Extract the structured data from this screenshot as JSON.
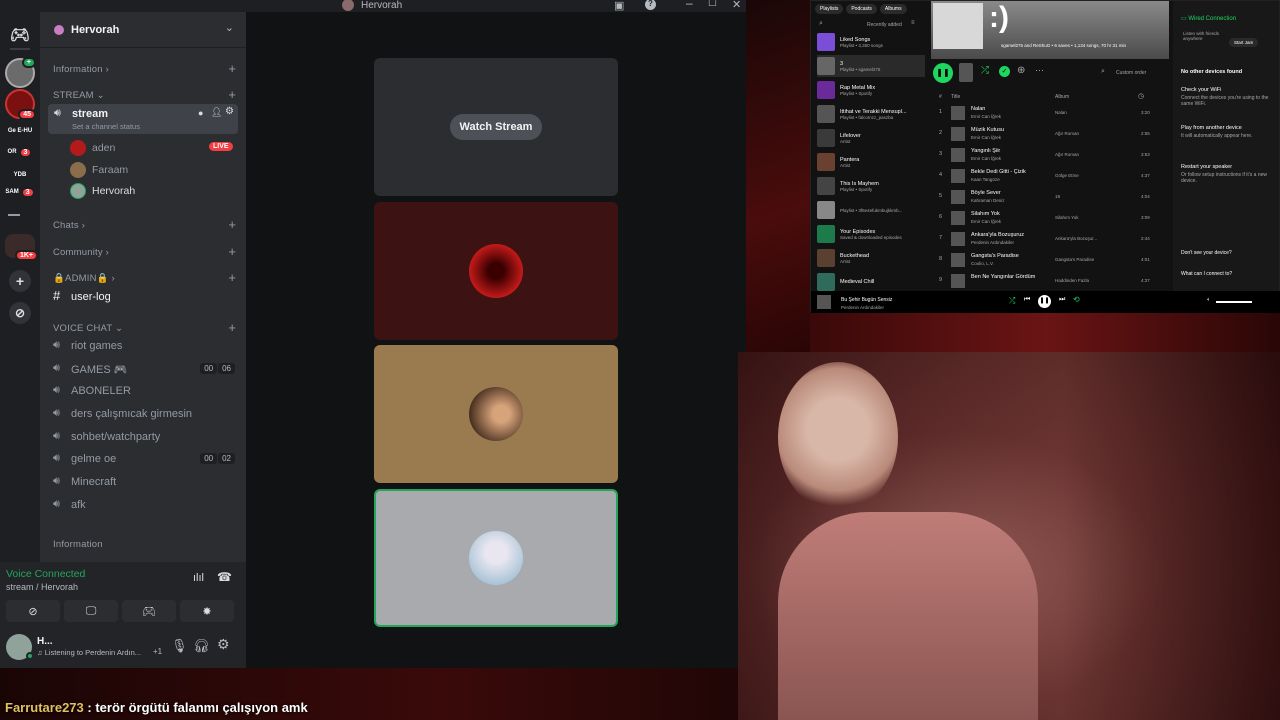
{
  "discord": {
    "window_title": "Hervorah",
    "server_name": "Hervorah",
    "servers": [
      {
        "label": "",
        "badge": ""
      },
      {
        "label": "",
        "badge": "45"
      },
      {
        "label": "Ge E-HU",
        "badge": ""
      },
      {
        "label": "OR",
        "badge": "3"
      },
      {
        "label": "YDB",
        "badge": ""
      },
      {
        "label": "SAM",
        "badge": "3"
      },
      {
        "label": "",
        "badge": "1K+"
      }
    ],
    "sections": {
      "information": "Information",
      "stream": "STREAM",
      "chats": "Chats",
      "community": "Community",
      "admin": "🔒ADMIN🔒",
      "voice_chat": "VOICE CHAT",
      "information2": "Information"
    },
    "stream_channel": {
      "name": "stream",
      "status": "Set a channel status"
    },
    "members": [
      {
        "name": "aden",
        "live": "LIVE"
      },
      {
        "name": "Faraam",
        "live": ""
      },
      {
        "name": "Hervorah",
        "live": ""
      }
    ],
    "text_channel": "user-log",
    "voice_channels": [
      {
        "name": "riot games",
        "c1": "",
        "c2": ""
      },
      {
        "name": "GAMES 🎮",
        "c1": "00",
        "c2": "06"
      },
      {
        "name": "ABONELER",
        "c1": "",
        "c2": ""
      },
      {
        "name": "ders çalışmıcak girmesin",
        "c1": "",
        "c2": ""
      },
      {
        "name": "sohbet/watchparty",
        "c1": "",
        "c2": ""
      },
      {
        "name": "gelme oe",
        "c1": "00",
        "c2": "02"
      },
      {
        "name": "Minecraft",
        "c1": "",
        "c2": ""
      },
      {
        "name": "afk",
        "c1": "",
        "c2": ""
      }
    ],
    "voice_connected": {
      "title": "Voice Connected",
      "sub": "stream / Hervorah"
    },
    "user": {
      "name": "H...",
      "activity": "Listening to Perdenin Ardın...",
      "extra": "+1"
    },
    "watch_stream": "Watch Stream",
    "colors": {
      "accent": "#23a55a",
      "live": "#f23f43"
    }
  },
  "spotify": {
    "tabs": [
      "Playlists",
      "Podcasts",
      "Albums"
    ],
    "sort": "Recently added",
    "library": [
      {
        "t": "Liked Songs",
        "s": "Playlist • 3,350 songs"
      },
      {
        "t": "3",
        "s": "Playlist • sgamel275"
      },
      {
        "t": "Rap Metal Mix",
        "s": "Playlist • Spotify"
      },
      {
        "t": "İttihat ve Terakki Mensupl...",
        "s": "Playlist • falcomzz_paszba"
      },
      {
        "t": "Lifelover",
        "s": "Artist"
      },
      {
        "t": "Pantera",
        "s": "Artist"
      },
      {
        "t": "This Is Mayhem",
        "s": "Playlist • Spotify"
      },
      {
        "t": "",
        "s": "Playlist • 3f6e4efukmbujkkmb..."
      },
      {
        "t": "Your Episodes",
        "s": "Saved & downloaded episodes"
      },
      {
        "t": "Buckethead",
        "s": "Artist"
      },
      {
        "t": "Medieval Chill",
        "s": ""
      }
    ],
    "playlist_title": ":)",
    "playlist_meta": "sgamel275 and ReShuG • 6 saves • 1,134 songs, 70 hr 31 min",
    "custom_order": "Custom order",
    "col_title": "Title",
    "col_album": "Album",
    "tracks": [
      {
        "n": "1",
        "t": "Nalan",
        "a": "Emir Can İğrek",
        "al": "Nalan",
        "d": "3:20"
      },
      {
        "n": "2",
        "t": "Müzik Kutusu",
        "a": "Emir Can İğrek",
        "al": "Ağır Roman",
        "d": "2:55"
      },
      {
        "n": "3",
        "t": "Yangınlı Şiir",
        "a": "Emir Can İğrek",
        "al": "Ağır Roman",
        "d": "3:53"
      },
      {
        "n": "4",
        "t": "Bekle Dedi Gitti - Çizik",
        "a": "Kaan Tangöze",
        "al": "Gölge Etme",
        "d": "4:37"
      },
      {
        "n": "5",
        "t": "Böyle Sever",
        "a": "Kahraman Deniz",
        "al": "19",
        "d": "4:04"
      },
      {
        "n": "6",
        "t": "Silahım Yok",
        "a": "Emir Can İğrek",
        "al": "Silahım Yok",
        "d": "3:09"
      },
      {
        "n": "7",
        "t": "Ankara'yla Bozuşuruz",
        "a": "Perdenin Ardındakiler",
        "al": "Ankara'yla Bozuşur...",
        "d": "2:44"
      },
      {
        "n": "8",
        "t": "Gangsta's Paradise",
        "a": "Coolio, L.V.",
        "al": "Gangsta's Paradise",
        "d": "4:01"
      },
      {
        "n": "9",
        "t": "Ben Ne Yangınlar Gördüm",
        "a": "",
        "al": "Haddinden Fazla",
        "d": "4:37"
      }
    ],
    "now_playing": {
      "t": "Bu Şehir Bugün Sensiz",
      "a": "Perdenin Ardındakiler"
    },
    "devices": {
      "current": "Wired Connection",
      "listen": "Listen with friends anywhere",
      "start_jam": "Start Jam",
      "no_other": "No other devices found",
      "wifi_t": "Check your WiFi",
      "wifi_s": "Connect the devices you're using to the same WiFi.",
      "play_t": "Play from another device",
      "play_s": "It will automatically appear here.",
      "restart_t": "Restart your speaker",
      "restart_s": "Or follow setup instructions if it's a new device.",
      "dont_see": "Don't see your device?",
      "connect": "What can I connect to?"
    }
  },
  "chat_message": {
    "user": "Farrutare273",
    "text": " : terör örgütü falanmı çalışıyon amk"
  }
}
